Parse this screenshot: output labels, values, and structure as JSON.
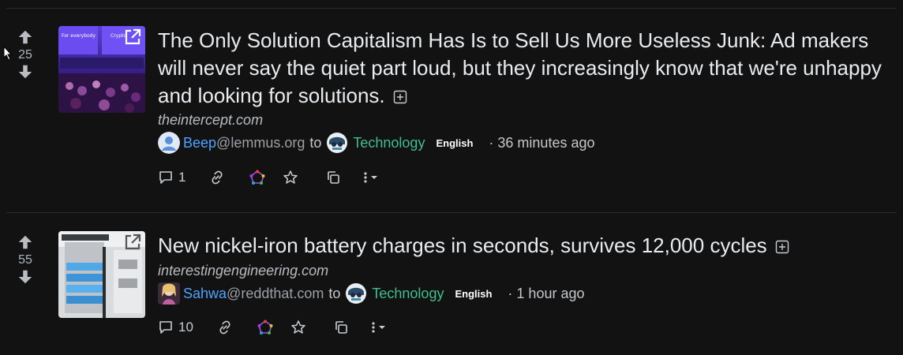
{
  "posts": [
    {
      "score": "25",
      "title": "The Only Solution Capitalism Has Is to Sell Us More Useless Junk: Ad makers will never say the quiet part loud, but they increasingly know that we're unhappy and looking for solutions.",
      "domain": "theintercept.com",
      "user": "Beep",
      "instance": "@lemmus.org",
      "to_word": "to",
      "community": "Technology",
      "language": "English",
      "time": "· 36 minutes ago",
      "comments": "1",
      "thumbnail_text_left": "For everybody",
      "thumbnail_text_right": "Crypto"
    },
    {
      "score": "55",
      "title": "New nickel-iron battery charges in seconds, survives 12,000 cycles",
      "domain": "interestingengineering.com",
      "user": "Sahwa",
      "instance": "@reddthat.com",
      "to_word": "to",
      "community": "Technology",
      "language": "English",
      "time": "· 1 hour ago",
      "comments": "10"
    }
  ],
  "colors": {
    "background": "#121212",
    "user_link": "#4da3ff",
    "community_link": "#3fbf8f"
  }
}
